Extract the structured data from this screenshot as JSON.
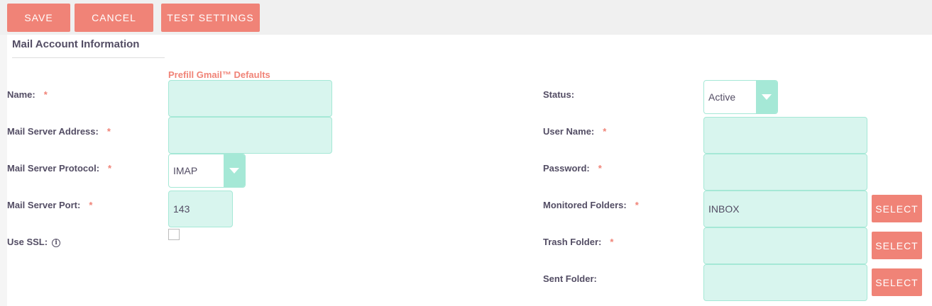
{
  "toolbar": {
    "save_label": "SAVE",
    "cancel_label": "CANCEL",
    "test_settings_label": "TEST SETTINGS"
  },
  "panel": {
    "title": "Mail Account Information",
    "prefill_link": "Prefill Gmail™ Defaults"
  },
  "left_fields": {
    "name": {
      "label": "Name:",
      "required": "*",
      "value": ""
    },
    "server_address": {
      "label": "Mail Server Address:",
      "required": "*",
      "value": ""
    },
    "protocol": {
      "label": "Mail Server Protocol:",
      "required": "*",
      "value": "IMAP"
    },
    "port": {
      "label": "Mail Server Port:",
      "required": "*",
      "value": "143"
    },
    "ssl": {
      "label": "Use SSL:",
      "info_icon": "info-icon",
      "checked": false
    }
  },
  "right_fields": {
    "status": {
      "label": "Status:",
      "value": "Active"
    },
    "user_name": {
      "label": "User Name:",
      "required": "*",
      "value": ""
    },
    "password": {
      "label": "Password:",
      "required": "*",
      "value": ""
    },
    "monitored_folders": {
      "label": "Monitored Folders:",
      "required": "*",
      "value": "INBOX",
      "button": "SELECT"
    },
    "trash_folder": {
      "label": "Trash Folder:",
      "required": "*",
      "value": "",
      "button": "SELECT"
    },
    "sent_folder": {
      "label": "Sent Folder:",
      "value": "",
      "button": "SELECT"
    }
  },
  "colors": {
    "accent": "#f08377",
    "input_bg": "#d8f5ee",
    "input_border": "#a5e8d6",
    "text": "#534d64"
  }
}
